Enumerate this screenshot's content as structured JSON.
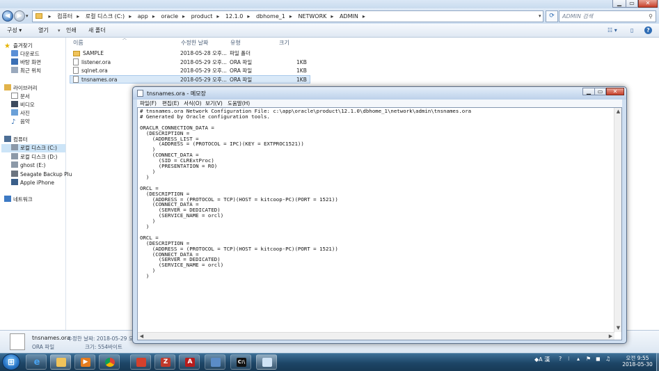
{
  "explorer": {
    "breadcrumb": [
      "컴퓨터",
      "로컬 디스크 (C:)",
      "app",
      "oracle",
      "product",
      "12.1.0",
      "dbhome_1",
      "NETWORK",
      "ADMIN"
    ],
    "search_placeholder": "ADMIN 검색",
    "toolbar": {
      "organize": "구성 ▾",
      "open": "열기",
      "print": "인쇄",
      "new_folder": "새 폴더"
    },
    "columns": {
      "name": "이름",
      "modified": "수정한 날짜",
      "type": "유형",
      "size": "크기"
    },
    "files": [
      {
        "name": "SAMPLE",
        "modified": "2018-05-28 오후...",
        "type": "파일 폴더",
        "size": "",
        "kind": "folder"
      },
      {
        "name": "listener.ora",
        "modified": "2018-05-29 오후...",
        "type": "ORA 파일",
        "size": "1KB",
        "kind": "file"
      },
      {
        "name": "sqlnet.ora",
        "modified": "2018-05-29 오후...",
        "type": "ORA 파일",
        "size": "1KB",
        "kind": "file"
      },
      {
        "name": "tnsnames.ora",
        "modified": "2018-05-29 오후...",
        "type": "ORA 파일",
        "size": "1KB",
        "kind": "file"
      }
    ],
    "sidebar": {
      "favorites": "즐겨찾기",
      "downloads": "다운로드",
      "desktop": "바탕 화면",
      "recent": "최근 위치",
      "libraries": "라이브러리",
      "documents": "문서",
      "videos": "비디오",
      "pictures": "사진",
      "music": "음악",
      "computer": "컴퓨터",
      "drive_c": "로컬 디스크 (C:)",
      "drive_d": "로컬 디스크 (D:)",
      "drive_e": "ghost (E:)",
      "seagate": "Seagate Backup Plu",
      "iphone": "Apple iPhone",
      "network": "네트워크"
    },
    "details": {
      "filename": "tnsnames.ora",
      "modified": "수정한 날짜: 2018-05-29 오후",
      "type": "ORA 파일",
      "size": "크기: 554바이트"
    }
  },
  "notepad": {
    "title": "tnsnames.ora - 메모장",
    "menu": [
      "파일(F)",
      "편집(E)",
      "서식(O)",
      "보기(V)",
      "도움말(H)"
    ],
    "content": "# tnsnames.ora Network Configuration File: c:\\app\\oracle\\product\\12.1.0\\dbhome_1\\network\\admin\\tnsnames.ora\n# Generated by Oracle configuration tools.\n\nORACLR_CONNECTION_DATA =\n  (DESCRIPTION =\n    (ADDRESS_LIST =\n      (ADDRESS = (PROTOCOL = IPC)(KEY = EXTPROC1521))\n    )\n    (CONNECT_DATA =\n      (SID = CLRExtProc)\n      (PRESENTATION = RO)\n    )\n  )\n\nORCL =\n  (DESCRIPTION =\n    (ADDRESS = (PROTOCOL = TCP)(HOST = kitcoop-PC)(PORT = 1521))\n    (CONNECT_DATA =\n      (SERVER = DEDICATED)\n      (SERVICE_NAME = orcl)\n    )\n  )\n\nORCL =\n  (DESCRIPTION =\n    (ADDRESS = (PROTOCOL = TCP)(HOST = kitcoop-PC)(PORT = 1521))\n    (CONNECT_DATA =\n      (SERVER = DEDICATED)\n      (SERVICE_NAME = orcl)\n    )\n  )"
  },
  "taskbar": {
    "ime_lang": "A",
    "ime_hanja": "漢",
    "time": "오전 9:55",
    "date": "2018-05-30"
  }
}
